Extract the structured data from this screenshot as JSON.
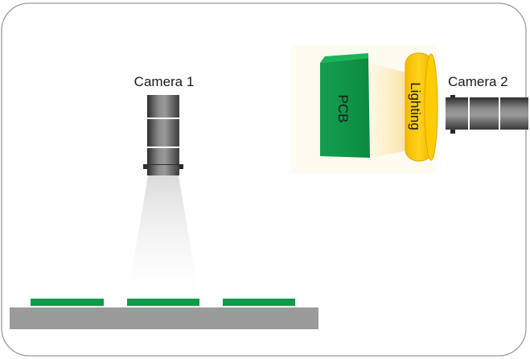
{
  "labels": {
    "camera1": "Camera 1",
    "camera2": "Camera 2",
    "pcb": "PCB",
    "lighting": "Lighting"
  },
  "colors": {
    "frame_border": "#9a9a9a",
    "pcb_green": "#0f9a4a",
    "pcb_green_dark": "#0b7f3a",
    "lighting_yellow": "#f7c600",
    "lighting_outline": "#e0a800",
    "camera_gray": "#6e6e6e",
    "camera_dark": "#3a3a3a",
    "conveyor_gray": "#9a9a9a"
  },
  "icons": {
    "camera1": "camera-icon",
    "camera2": "camera-icon",
    "lighting": "ring-light-icon"
  }
}
